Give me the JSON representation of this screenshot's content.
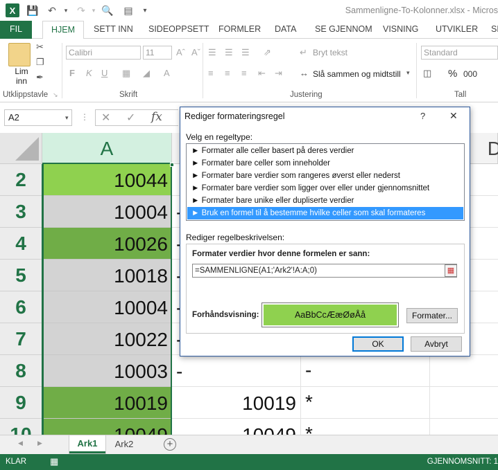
{
  "window": {
    "title": "Sammenligne-To-Kolonner.xlsx - Micros"
  },
  "tabs": [
    "FIL",
    "HJEM",
    "SETT INN",
    "SIDEOPPSETT",
    "FORMLER",
    "DATA",
    "SE GJENNOM",
    "VISNING",
    "UTVIKLER",
    "SK"
  ],
  "ribbon": {
    "paste_label": "Lim inn",
    "clipboard_label": "Utklippstavle",
    "font_name": "Calibri",
    "font_size": "11",
    "font_label": "Skrift",
    "wrap_text": "Bryt tekst",
    "merge_center": "Slå sammen og midtstill",
    "alignment_label": "Justering",
    "number_format": "Standard",
    "number_label": "Tall",
    "percent": "%",
    "thousands": "000"
  },
  "formula_bar": {
    "name_box": "A2",
    "fx": "fx"
  },
  "grid": {
    "col_a": "A",
    "col_d": "D",
    "rows": [
      {
        "num": "2",
        "a": "10044",
        "fill": "#8fd14f",
        "b": "",
        "c": ""
      },
      {
        "num": "3",
        "a": "10004",
        "fill": "#d3d3d3",
        "b": "-",
        "c": ""
      },
      {
        "num": "4",
        "a": "10026",
        "fill": "#70ad47",
        "b": "-",
        "c": ""
      },
      {
        "num": "5",
        "a": "10018",
        "fill": "#d3d3d3",
        "b": "-",
        "c": ""
      },
      {
        "num": "6",
        "a": "10004",
        "fill": "#d3d3d3",
        "b": "-",
        "c": ""
      },
      {
        "num": "7",
        "a": "10022",
        "fill": "#d3d3d3",
        "b": "-",
        "c": ""
      },
      {
        "num": "8",
        "a": "10003",
        "fill": "#d3d3d3",
        "b": "-",
        "c": "-"
      },
      {
        "num": "9",
        "a": "10019",
        "fill": "#70ad47",
        "b": "10019",
        "c": "*"
      },
      {
        "num": "10",
        "a": "10049",
        "fill": "#70ad47",
        "b": "10049",
        "c": "*"
      }
    ]
  },
  "sheets": {
    "sheet1": "Ark1",
    "sheet2": "Ark2"
  },
  "status": {
    "ready": "KLAR",
    "average": "GJENNOMSNITT: 1"
  },
  "dialog": {
    "title": "Rediger formateringsregel",
    "help": "?",
    "close": "✕",
    "select_rule_type": "Velg en regeltype:",
    "rule_types": [
      "► Formater alle celler basert på deres verdier",
      "► Formater bare celler som inneholder",
      "► Formater bare verdier som rangeres øverst eller nederst",
      "► Formater bare verdier som ligger over eller under gjennomsnittet",
      "► Formater bare unike eller dupliserte verdier",
      "► Bruk en formel til å bestemme hvilke celler som skal formateres"
    ],
    "selected_rule_index": 5,
    "edit_description": "Rediger regelbeskrivelsen:",
    "formula_label": "Formater verdier hvor denne formelen er sann:",
    "formula_value": "=SAMMENLIGNE(A1;'Ark2'!A:A;0)",
    "preview_label": "Forhåndsvisning:",
    "preview_text": "AaBbCcÆæØøÅå",
    "format_button": "Formater...",
    "ok": "OK",
    "cancel": "Avbryt"
  }
}
